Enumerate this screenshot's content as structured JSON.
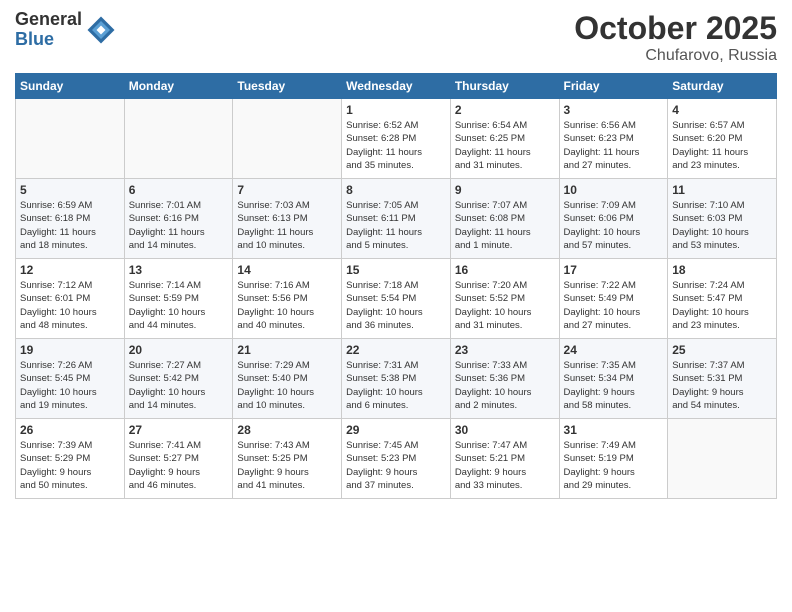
{
  "logo": {
    "general": "General",
    "blue": "Blue"
  },
  "title": "October 2025",
  "subtitle": "Chufarovo, Russia",
  "days_of_week": [
    "Sunday",
    "Monday",
    "Tuesday",
    "Wednesday",
    "Thursday",
    "Friday",
    "Saturday"
  ],
  "weeks": [
    [
      {
        "day": "",
        "info": ""
      },
      {
        "day": "",
        "info": ""
      },
      {
        "day": "",
        "info": ""
      },
      {
        "day": "1",
        "info": "Sunrise: 6:52 AM\nSunset: 6:28 PM\nDaylight: 11 hours\nand 35 minutes."
      },
      {
        "day": "2",
        "info": "Sunrise: 6:54 AM\nSunset: 6:25 PM\nDaylight: 11 hours\nand 31 minutes."
      },
      {
        "day": "3",
        "info": "Sunrise: 6:56 AM\nSunset: 6:23 PM\nDaylight: 11 hours\nand 27 minutes."
      },
      {
        "day": "4",
        "info": "Sunrise: 6:57 AM\nSunset: 6:20 PM\nDaylight: 11 hours\nand 23 minutes."
      }
    ],
    [
      {
        "day": "5",
        "info": "Sunrise: 6:59 AM\nSunset: 6:18 PM\nDaylight: 11 hours\nand 18 minutes."
      },
      {
        "day": "6",
        "info": "Sunrise: 7:01 AM\nSunset: 6:16 PM\nDaylight: 11 hours\nand 14 minutes."
      },
      {
        "day": "7",
        "info": "Sunrise: 7:03 AM\nSunset: 6:13 PM\nDaylight: 11 hours\nand 10 minutes."
      },
      {
        "day": "8",
        "info": "Sunrise: 7:05 AM\nSunset: 6:11 PM\nDaylight: 11 hours\nand 5 minutes."
      },
      {
        "day": "9",
        "info": "Sunrise: 7:07 AM\nSunset: 6:08 PM\nDaylight: 11 hours\nand 1 minute."
      },
      {
        "day": "10",
        "info": "Sunrise: 7:09 AM\nSunset: 6:06 PM\nDaylight: 10 hours\nand 57 minutes."
      },
      {
        "day": "11",
        "info": "Sunrise: 7:10 AM\nSunset: 6:03 PM\nDaylight: 10 hours\nand 53 minutes."
      }
    ],
    [
      {
        "day": "12",
        "info": "Sunrise: 7:12 AM\nSunset: 6:01 PM\nDaylight: 10 hours\nand 48 minutes."
      },
      {
        "day": "13",
        "info": "Sunrise: 7:14 AM\nSunset: 5:59 PM\nDaylight: 10 hours\nand 44 minutes."
      },
      {
        "day": "14",
        "info": "Sunrise: 7:16 AM\nSunset: 5:56 PM\nDaylight: 10 hours\nand 40 minutes."
      },
      {
        "day": "15",
        "info": "Sunrise: 7:18 AM\nSunset: 5:54 PM\nDaylight: 10 hours\nand 36 minutes."
      },
      {
        "day": "16",
        "info": "Sunrise: 7:20 AM\nSunset: 5:52 PM\nDaylight: 10 hours\nand 31 minutes."
      },
      {
        "day": "17",
        "info": "Sunrise: 7:22 AM\nSunset: 5:49 PM\nDaylight: 10 hours\nand 27 minutes."
      },
      {
        "day": "18",
        "info": "Sunrise: 7:24 AM\nSunset: 5:47 PM\nDaylight: 10 hours\nand 23 minutes."
      }
    ],
    [
      {
        "day": "19",
        "info": "Sunrise: 7:26 AM\nSunset: 5:45 PM\nDaylight: 10 hours\nand 19 minutes."
      },
      {
        "day": "20",
        "info": "Sunrise: 7:27 AM\nSunset: 5:42 PM\nDaylight: 10 hours\nand 14 minutes."
      },
      {
        "day": "21",
        "info": "Sunrise: 7:29 AM\nSunset: 5:40 PM\nDaylight: 10 hours\nand 10 minutes."
      },
      {
        "day": "22",
        "info": "Sunrise: 7:31 AM\nSunset: 5:38 PM\nDaylight: 10 hours\nand 6 minutes."
      },
      {
        "day": "23",
        "info": "Sunrise: 7:33 AM\nSunset: 5:36 PM\nDaylight: 10 hours\nand 2 minutes."
      },
      {
        "day": "24",
        "info": "Sunrise: 7:35 AM\nSunset: 5:34 PM\nDaylight: 9 hours\nand 58 minutes."
      },
      {
        "day": "25",
        "info": "Sunrise: 7:37 AM\nSunset: 5:31 PM\nDaylight: 9 hours\nand 54 minutes."
      }
    ],
    [
      {
        "day": "26",
        "info": "Sunrise: 7:39 AM\nSunset: 5:29 PM\nDaylight: 9 hours\nand 50 minutes."
      },
      {
        "day": "27",
        "info": "Sunrise: 7:41 AM\nSunset: 5:27 PM\nDaylight: 9 hours\nand 46 minutes."
      },
      {
        "day": "28",
        "info": "Sunrise: 7:43 AM\nSunset: 5:25 PM\nDaylight: 9 hours\nand 41 minutes."
      },
      {
        "day": "29",
        "info": "Sunrise: 7:45 AM\nSunset: 5:23 PM\nDaylight: 9 hours\nand 37 minutes."
      },
      {
        "day": "30",
        "info": "Sunrise: 7:47 AM\nSunset: 5:21 PM\nDaylight: 9 hours\nand 33 minutes."
      },
      {
        "day": "31",
        "info": "Sunrise: 7:49 AM\nSunset: 5:19 PM\nDaylight: 9 hours\nand 29 minutes."
      },
      {
        "day": "",
        "info": ""
      }
    ]
  ]
}
